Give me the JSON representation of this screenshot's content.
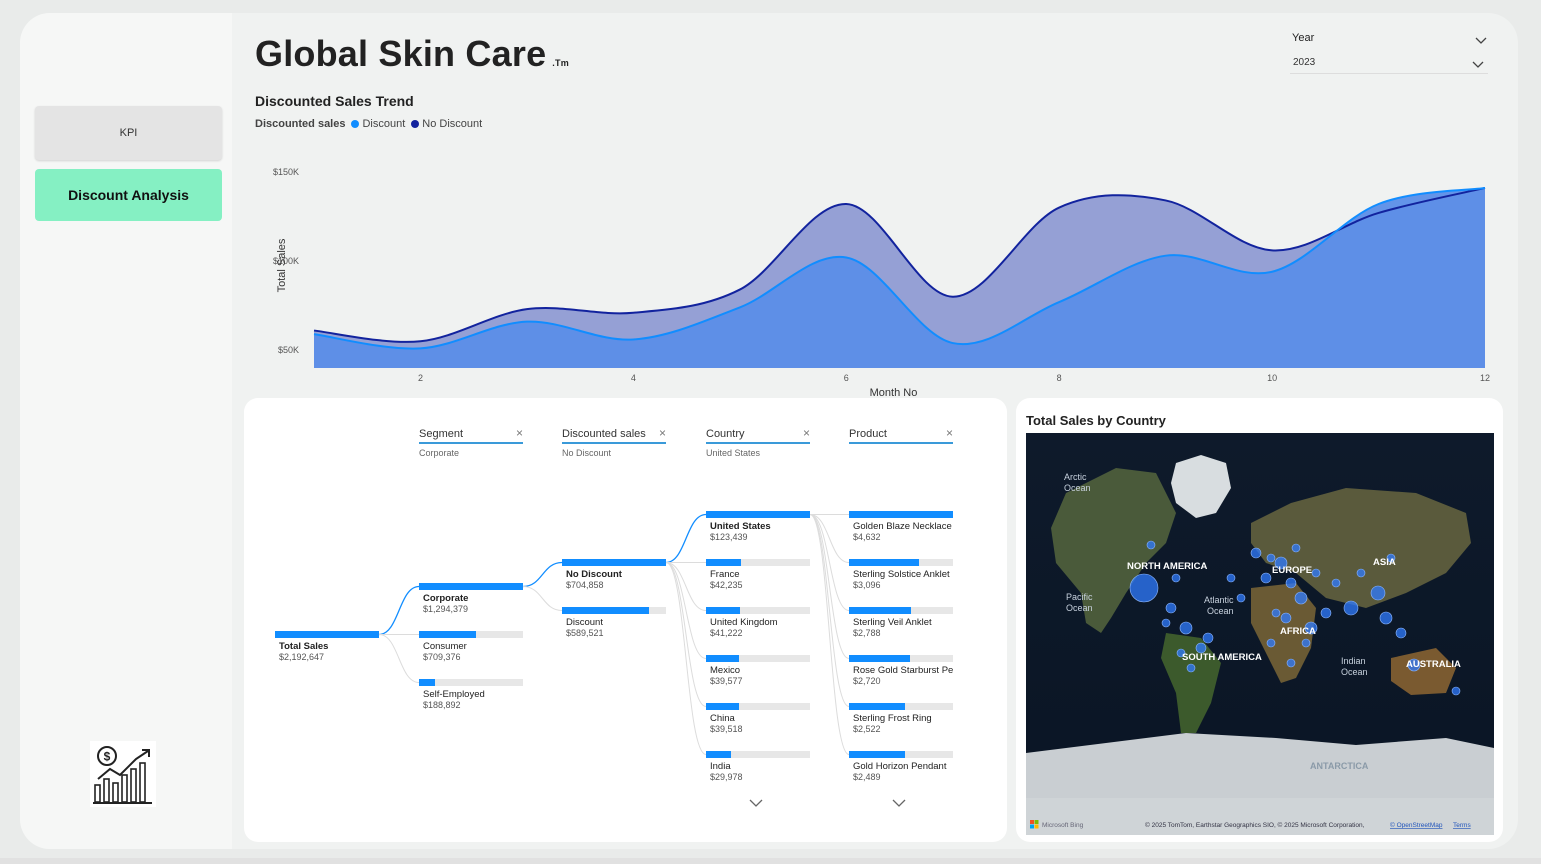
{
  "app": {
    "title": "Global Skin Care",
    "trademark": ".Tm"
  },
  "nav": {
    "kpi_label": "KPI",
    "discount_label": "Discount Analysis",
    "logo_icon": "dollar-growth-chart-icon"
  },
  "slicer": {
    "label": "Year",
    "value": "2023"
  },
  "trend": {
    "title": "Discounted Sales Trend",
    "legend_title": "Discounted sales",
    "series_names": [
      "Discount",
      "No Discount"
    ],
    "colors": {
      "discount": "#118dff",
      "no_discount": "#12239e"
    }
  },
  "chart_data": {
    "type": "area",
    "title": "Discounted Sales Trend",
    "xlabel": "Month No",
    "ylabel": "Total Sales",
    "x": [
      1,
      2,
      3,
      4,
      5,
      6,
      7,
      8,
      9,
      10,
      11,
      12
    ],
    "xticks": [
      2,
      4,
      6,
      8,
      10,
      12
    ],
    "yticks": [
      50000,
      100000,
      150000
    ],
    "ytick_labels": [
      "$50K",
      "$100K",
      "$150K"
    ],
    "ylim": [
      40000,
      155000
    ],
    "legend_title": "Discounted sales",
    "legend": "top-left",
    "series": [
      {
        "name": "Discount",
        "color": "#118dff",
        "values": [
          59000,
          51000,
          66000,
          56000,
          74000,
          102000,
          54000,
          77000,
          103000,
          94000,
          132000,
          141000
        ]
      },
      {
        "name": "No Discount",
        "color": "#12239e",
        "values": [
          61000,
          55000,
          73000,
          71000,
          84000,
          132000,
          80000,
          130000,
          134000,
          106000,
          127000,
          141000
        ]
      }
    ]
  },
  "tree": {
    "columns": [
      {
        "name": "Segment",
        "filter": "Corporate"
      },
      {
        "name": "Discounted sales",
        "filter": "No Discount"
      },
      {
        "name": "Country",
        "filter": "United States"
      },
      {
        "name": "Product",
        "filter": ""
      }
    ],
    "root": {
      "label": "Total Sales",
      "value": "$2,192,647",
      "fill": 1.0
    },
    "segment": [
      {
        "label": "Corporate",
        "value": "$1,294,379",
        "fill": 1.0,
        "selected": true
      },
      {
        "label": "Consumer",
        "value": "$709,376",
        "fill": 0.55,
        "selected": false
      },
      {
        "label": "Self-Employed",
        "value": "$188,892",
        "fill": 0.15,
        "selected": false
      }
    ],
    "discount": [
      {
        "label": "No Discount",
        "value": "$704,858",
        "fill": 1.0,
        "selected": true
      },
      {
        "label": "Discount",
        "value": "$589,521",
        "fill": 0.84,
        "selected": false
      }
    ],
    "country": [
      {
        "label": "United States",
        "value": "$123,439",
        "fill": 1.0,
        "selected": true
      },
      {
        "label": "France",
        "value": "$42,235",
        "fill": 0.34,
        "selected": false
      },
      {
        "label": "United Kingdom",
        "value": "$41,222",
        "fill": 0.33,
        "selected": false
      },
      {
        "label": "Mexico",
        "value": "$39,577",
        "fill": 0.32,
        "selected": false
      },
      {
        "label": "China",
        "value": "$39,518",
        "fill": 0.32,
        "selected": false
      },
      {
        "label": "India",
        "value": "$29,978",
        "fill": 0.24,
        "selected": false
      }
    ],
    "product": [
      {
        "label": "Golden Blaze Necklace",
        "value": "$4,632",
        "fill": 1.0
      },
      {
        "label": "Sterling Solstice Anklet",
        "value": "$3,096",
        "fill": 0.67
      },
      {
        "label": "Sterling Veil Anklet",
        "value": "$2,788",
        "fill": 0.6
      },
      {
        "label": "Rose Gold Starburst Pe...",
        "value": "$2,720",
        "fill": 0.59
      },
      {
        "label": "Sterling Frost Ring",
        "value": "$2,522",
        "fill": 0.54
      },
      {
        "label": "Gold Horizon Pendant",
        "value": "$2,489",
        "fill": 0.54
      }
    ]
  },
  "map": {
    "title": "Total Sales by Country",
    "labels": {
      "arctic": [
        "Arctic",
        "Ocean"
      ],
      "pacific": [
        "Pacific",
        "Ocean"
      ],
      "atlantic": [
        "Atlantic",
        "Ocean"
      ],
      "indian": [
        "Indian",
        "Ocean"
      ],
      "north_america": "NORTH AMERICA",
      "europe": "EUROPE",
      "asia": "ASIA",
      "africa": "AFRICA",
      "south_america": "SOUTH AMERICA",
      "australia": "AUSTRALIA",
      "antarctica": "ANTARCTICA"
    },
    "bing_label": "Microsoft Bing",
    "attribution": "© 2025 TomTom, Earthstar Geographics SIO, © 2025 Microsoft Corporation,",
    "osm_link": "© OpenStreetMap",
    "terms_link": "Terms"
  }
}
